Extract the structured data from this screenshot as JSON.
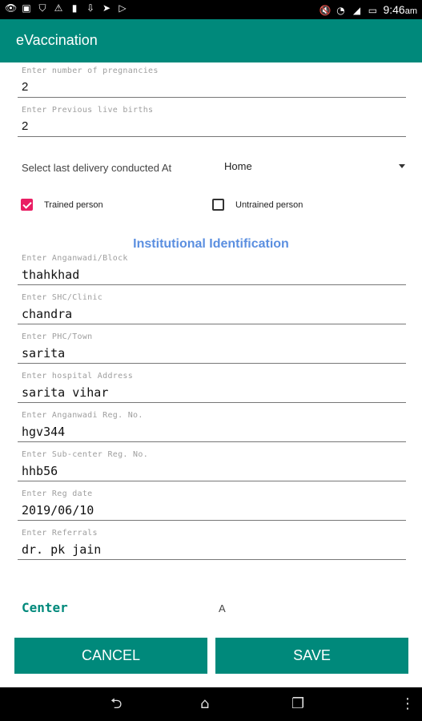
{
  "status_bar": {
    "time": "9:46",
    "time_suffix": "am",
    "icons": [
      "eye-icon",
      "image-icon",
      "shield-icon",
      "warning-icon",
      "lock-icon",
      "download-icon",
      "send-icon",
      "play-icon",
      "mute-icon",
      "wifi-icon",
      "signal-icon",
      "battery-icon"
    ]
  },
  "app_bar": {
    "title": "eVaccination"
  },
  "form": {
    "pregnancies": {
      "hint": "Enter number of pregnancies",
      "value": "2"
    },
    "live_births": {
      "hint": "Enter Previous live births",
      "value": "2"
    },
    "delivery": {
      "label": "Select last delivery conducted At",
      "selected": "Home"
    },
    "trained_person": {
      "label": "Trained person",
      "checked": true
    },
    "untrained_person": {
      "label": "Untrained person",
      "checked": false
    },
    "section_title": "Institutional Identification",
    "anganwadi_block": {
      "hint": "Enter Anganwadi/Block",
      "value": "thahkhad"
    },
    "shc_clinic": {
      "hint": "Enter SHC/Clinic",
      "value": "chandra"
    },
    "phc_town": {
      "hint": "Enter PHC/Town",
      "value": "sarita"
    },
    "hospital_address": {
      "hint": "Enter hospital Address",
      "value": "sarita vihar"
    },
    "anganwadi_reg": {
      "hint": "Enter Anganwadi Reg. No.",
      "value": "hgv344"
    },
    "subcenter_reg": {
      "hint": "Enter Sub-center Reg. No.",
      "value": "hhb56"
    },
    "reg_date": {
      "hint": "Enter Reg date",
      "value": "2019/06/10"
    },
    "referrals": {
      "hint": "Enter Referrals",
      "value": "dr. pk jain"
    },
    "center": {
      "label": "Center",
      "value": "A"
    }
  },
  "buttons": {
    "cancel": "CANCEL",
    "save": "SAVE"
  },
  "colors": {
    "primary": "#00897b",
    "accent": "#e91e63",
    "section_title": "#5b8fe0"
  }
}
